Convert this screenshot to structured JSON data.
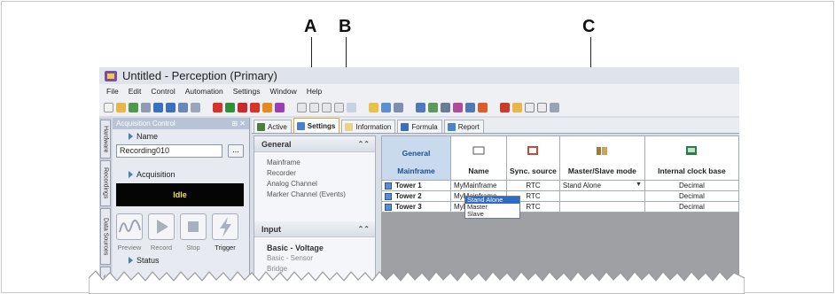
{
  "callouts": [
    "A",
    "B",
    "C"
  ],
  "window": {
    "title": "Untitled - Perception (Primary)"
  },
  "menu": [
    "File",
    "Edit",
    "Control",
    "Automation",
    "Settings",
    "Window",
    "Help"
  ],
  "sidebar_tabs": [
    "Hardware",
    "Recordings",
    "Data Sources",
    "Sr"
  ],
  "acquisition": {
    "panel_title": "Acquisition Control",
    "name_label": "Name",
    "name_value": "Recording010",
    "browse_label": "...",
    "acquisition_label": "Acquisition",
    "status_value": "Idle",
    "controls": [
      "Preview",
      "Record",
      "Stop",
      "Trigger"
    ],
    "status_label": "Status"
  },
  "settings_tabs": [
    "Active",
    "Settings",
    "Information",
    "Formula",
    "Report"
  ],
  "general_panel": {
    "title": "General",
    "items": [
      "Mainframe",
      "Recorder",
      "Analog Channel",
      "Marker Channel (Events)"
    ]
  },
  "input_panel": {
    "title": "Input",
    "items": [
      "Basic - Voltage",
      "Basic - Sensor",
      "Bridge"
    ]
  },
  "grid": {
    "corner": [
      "General",
      "Mainframe"
    ],
    "columns": [
      "Name",
      "Sync. source",
      "Master/Slave mode",
      "Internal clock base"
    ],
    "rows": [
      {
        "label": "Tower 1",
        "name": "MyMainframe",
        "sync": "RTC",
        "mode": "Stand Alone",
        "clock": "Decimal"
      },
      {
        "label": "Tower 2",
        "name": "MyMainframe",
        "sync": "RTC",
        "mode": "",
        "clock": "Decimal"
      },
      {
        "label": "Tower 3",
        "name": "MyMainframe",
        "sync": "RTC",
        "mode": "",
        "clock": "Decimal"
      }
    ],
    "dropdown_options": [
      "Stand Alone",
      "Master",
      "Slave"
    ],
    "dropdown_selected": "Stand Alone"
  },
  "colors": {
    "accent_tab": "#e4a62e",
    "status_bg": "#050505",
    "status_fg": "#f0e060",
    "selection": "#2f6bc4"
  }
}
